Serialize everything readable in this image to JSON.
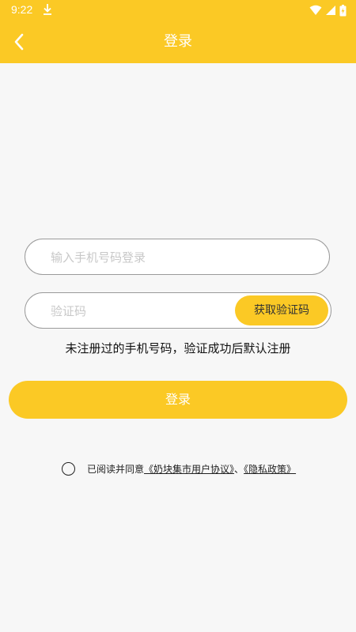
{
  "status_bar": {
    "time": "9:22",
    "icons": [
      "download-icon",
      "wifi-icon",
      "signal-icon",
      "battery-charging-icon"
    ]
  },
  "app_bar": {
    "title": "登录",
    "back_icon": "chevron-left-icon"
  },
  "form": {
    "phone_placeholder": "输入手机号码登录",
    "phone_value": "",
    "code_placeholder": "验证码",
    "code_value": "",
    "get_code_label": "获取验证码",
    "hint": "未注册过的手机号码，验证成功后默认注册",
    "login_label": "登录"
  },
  "agreement": {
    "prefix": "已阅读并同意",
    "user_agreement": "《奶块集市用户协议》",
    "separator": "、",
    "privacy_policy": "《隐私政策》",
    "checked": false
  },
  "colors": {
    "accent": "#fbc925",
    "background": "#f7f7f7",
    "text": "#111111",
    "placeholder": "#c8c8c8"
  }
}
